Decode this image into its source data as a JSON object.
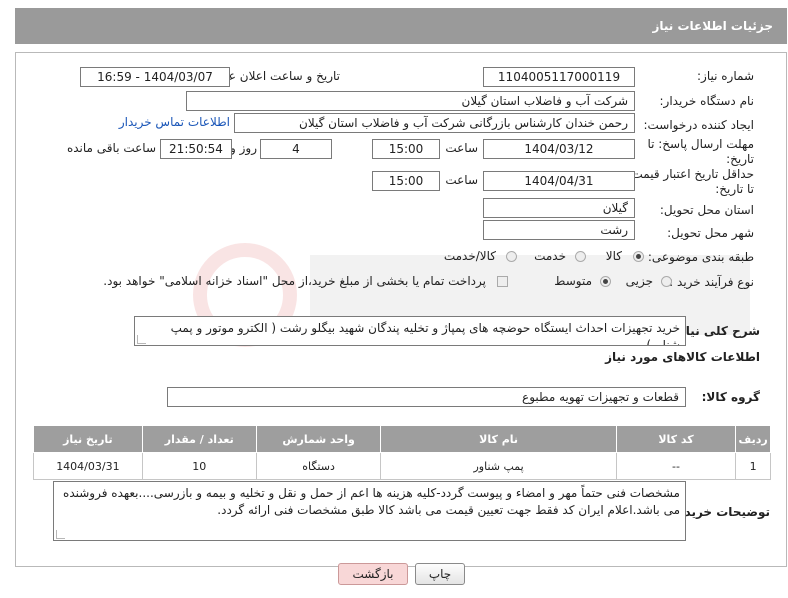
{
  "header": {
    "title": "جزئیات اطلاعات نیاز"
  },
  "form": {
    "need_number_label": "شماره نیاز:",
    "need_number": "1104005117000119",
    "announce_label": "تاریخ و ساعت اعلان عمومی:",
    "announce_value": "1404/03/07 - 16:59",
    "buyer_org_label": "نام دستگاه خریدار:",
    "buyer_org": "شرکت آب و فاضلاب استان گیلان",
    "creator_label": "ایجاد کننده درخواست:",
    "creator": "رحمن خندان کارشناس بازرگانی شرکت آب و فاضلاب استان گیلان",
    "contact_link": "اطلاعات تماس خریدار",
    "deadline_label": "مهلت ارسال پاسخ: تا تاریخ:",
    "deadline_date": "1404/03/12",
    "time_label": "ساعت",
    "deadline_time": "15:00",
    "days_value": "4",
    "days_label": "روز و",
    "remaining_time": "21:50:54",
    "remaining_label": "ساعت باقی مانده",
    "validity_label": "حداقل تاریخ اعتبار قیمت: تا تاریخ:",
    "validity_date": "1404/04/31",
    "validity_time": "15:00",
    "province_label": "استان محل تحویل:",
    "province": "گیلان",
    "city_label": "شهر محل تحویل:",
    "city": "رشت",
    "category_label": "طبقه بندی موضوعی:",
    "category_options": [
      "کالا",
      "خدمت",
      "کالا/خدمت"
    ],
    "category_selected": "کالا",
    "purchase_type_label": "نوع فرآیند خرید :",
    "purchase_options": [
      "جزیی",
      "متوسط"
    ],
    "purchase_selected": "متوسط",
    "payment_note": "پرداخت تمام یا بخشی از مبلغ خرید،از محل \"اسناد خزانه اسلامی\" خواهد بود.",
    "description_label": "شرح کلی نیاز:",
    "description": "خرید تجهیزات احداث ایستگاه حوضچه های پمپاژ و تخلیه پندگان شهید بیگلو رشت ( الکترو موتور و پمپ شناور)",
    "goods_info_title": "اطلاعات کالاهای مورد نیاز",
    "goods_group_label": "گروه کالا:",
    "goods_group": "قطعات و تجهیزات تهویه مطبوع"
  },
  "table": {
    "headers": [
      "ردیف",
      "کد کالا",
      "نام کالا",
      "واحد شمارش",
      "تعداد / مقدار",
      "تاریخ نیاز"
    ],
    "rows": [
      [
        "1",
        "--",
        "پمپ شناور",
        "دستگاه",
        "10",
        "1404/03/31"
      ]
    ]
  },
  "buyer_notes_label": "توضیحات خریدار:",
  "buyer_notes": "مشخصات فنی حتماً مهر و امضاء و پیوست گردد-کلیه هزینه ها اعم از حمل و نقل و تخلیه و بیمه و بازرسی....بعهده فروشنده می باشد.اعلام ایران کد فقط جهت تعیین قیمت می باشد کالا طبق مشخصات فنی ارائه گردد.",
  "buttons": {
    "print": "چاپ",
    "back": "بازگشت"
  },
  "colors": {
    "header_bg": "#9a9a9a",
    "link": "#1a56b8",
    "back_btn_bg": "#f8d7d7"
  }
}
